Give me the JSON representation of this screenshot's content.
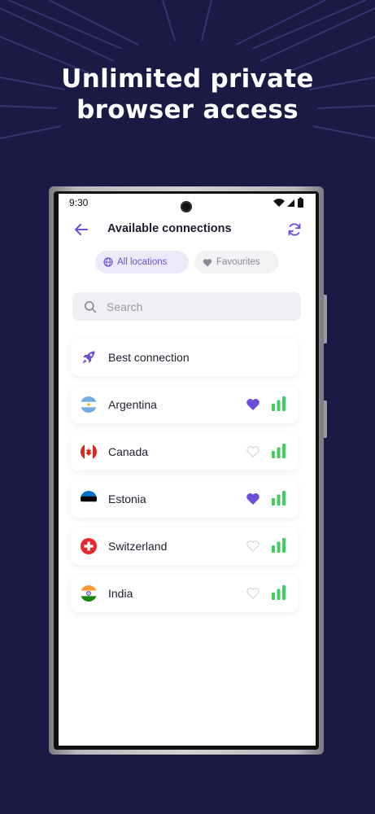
{
  "promo": {
    "headline_line1": "Unlimited private",
    "headline_line2": "browser access"
  },
  "status_bar": {
    "time": "9:30"
  },
  "header": {
    "title": "Available connections"
  },
  "tabs": [
    {
      "label": "All locations",
      "active": true
    },
    {
      "label": "Favourites",
      "active": false
    }
  ],
  "search": {
    "placeholder": "Search"
  },
  "best": {
    "label": "Best connection"
  },
  "locations": [
    {
      "name": "Argentina",
      "favourite": true
    },
    {
      "name": "Canada",
      "favourite": false
    },
    {
      "name": "Estonia",
      "favourite": true
    },
    {
      "name": "Switzerland",
      "favourite": false
    },
    {
      "name": "India",
      "favourite": false
    }
  ],
  "colors": {
    "background": "#1a1b45",
    "accent": "#6b4fd8",
    "signal": "#3ecf5e",
    "heart_empty": "#d5d5dc"
  }
}
